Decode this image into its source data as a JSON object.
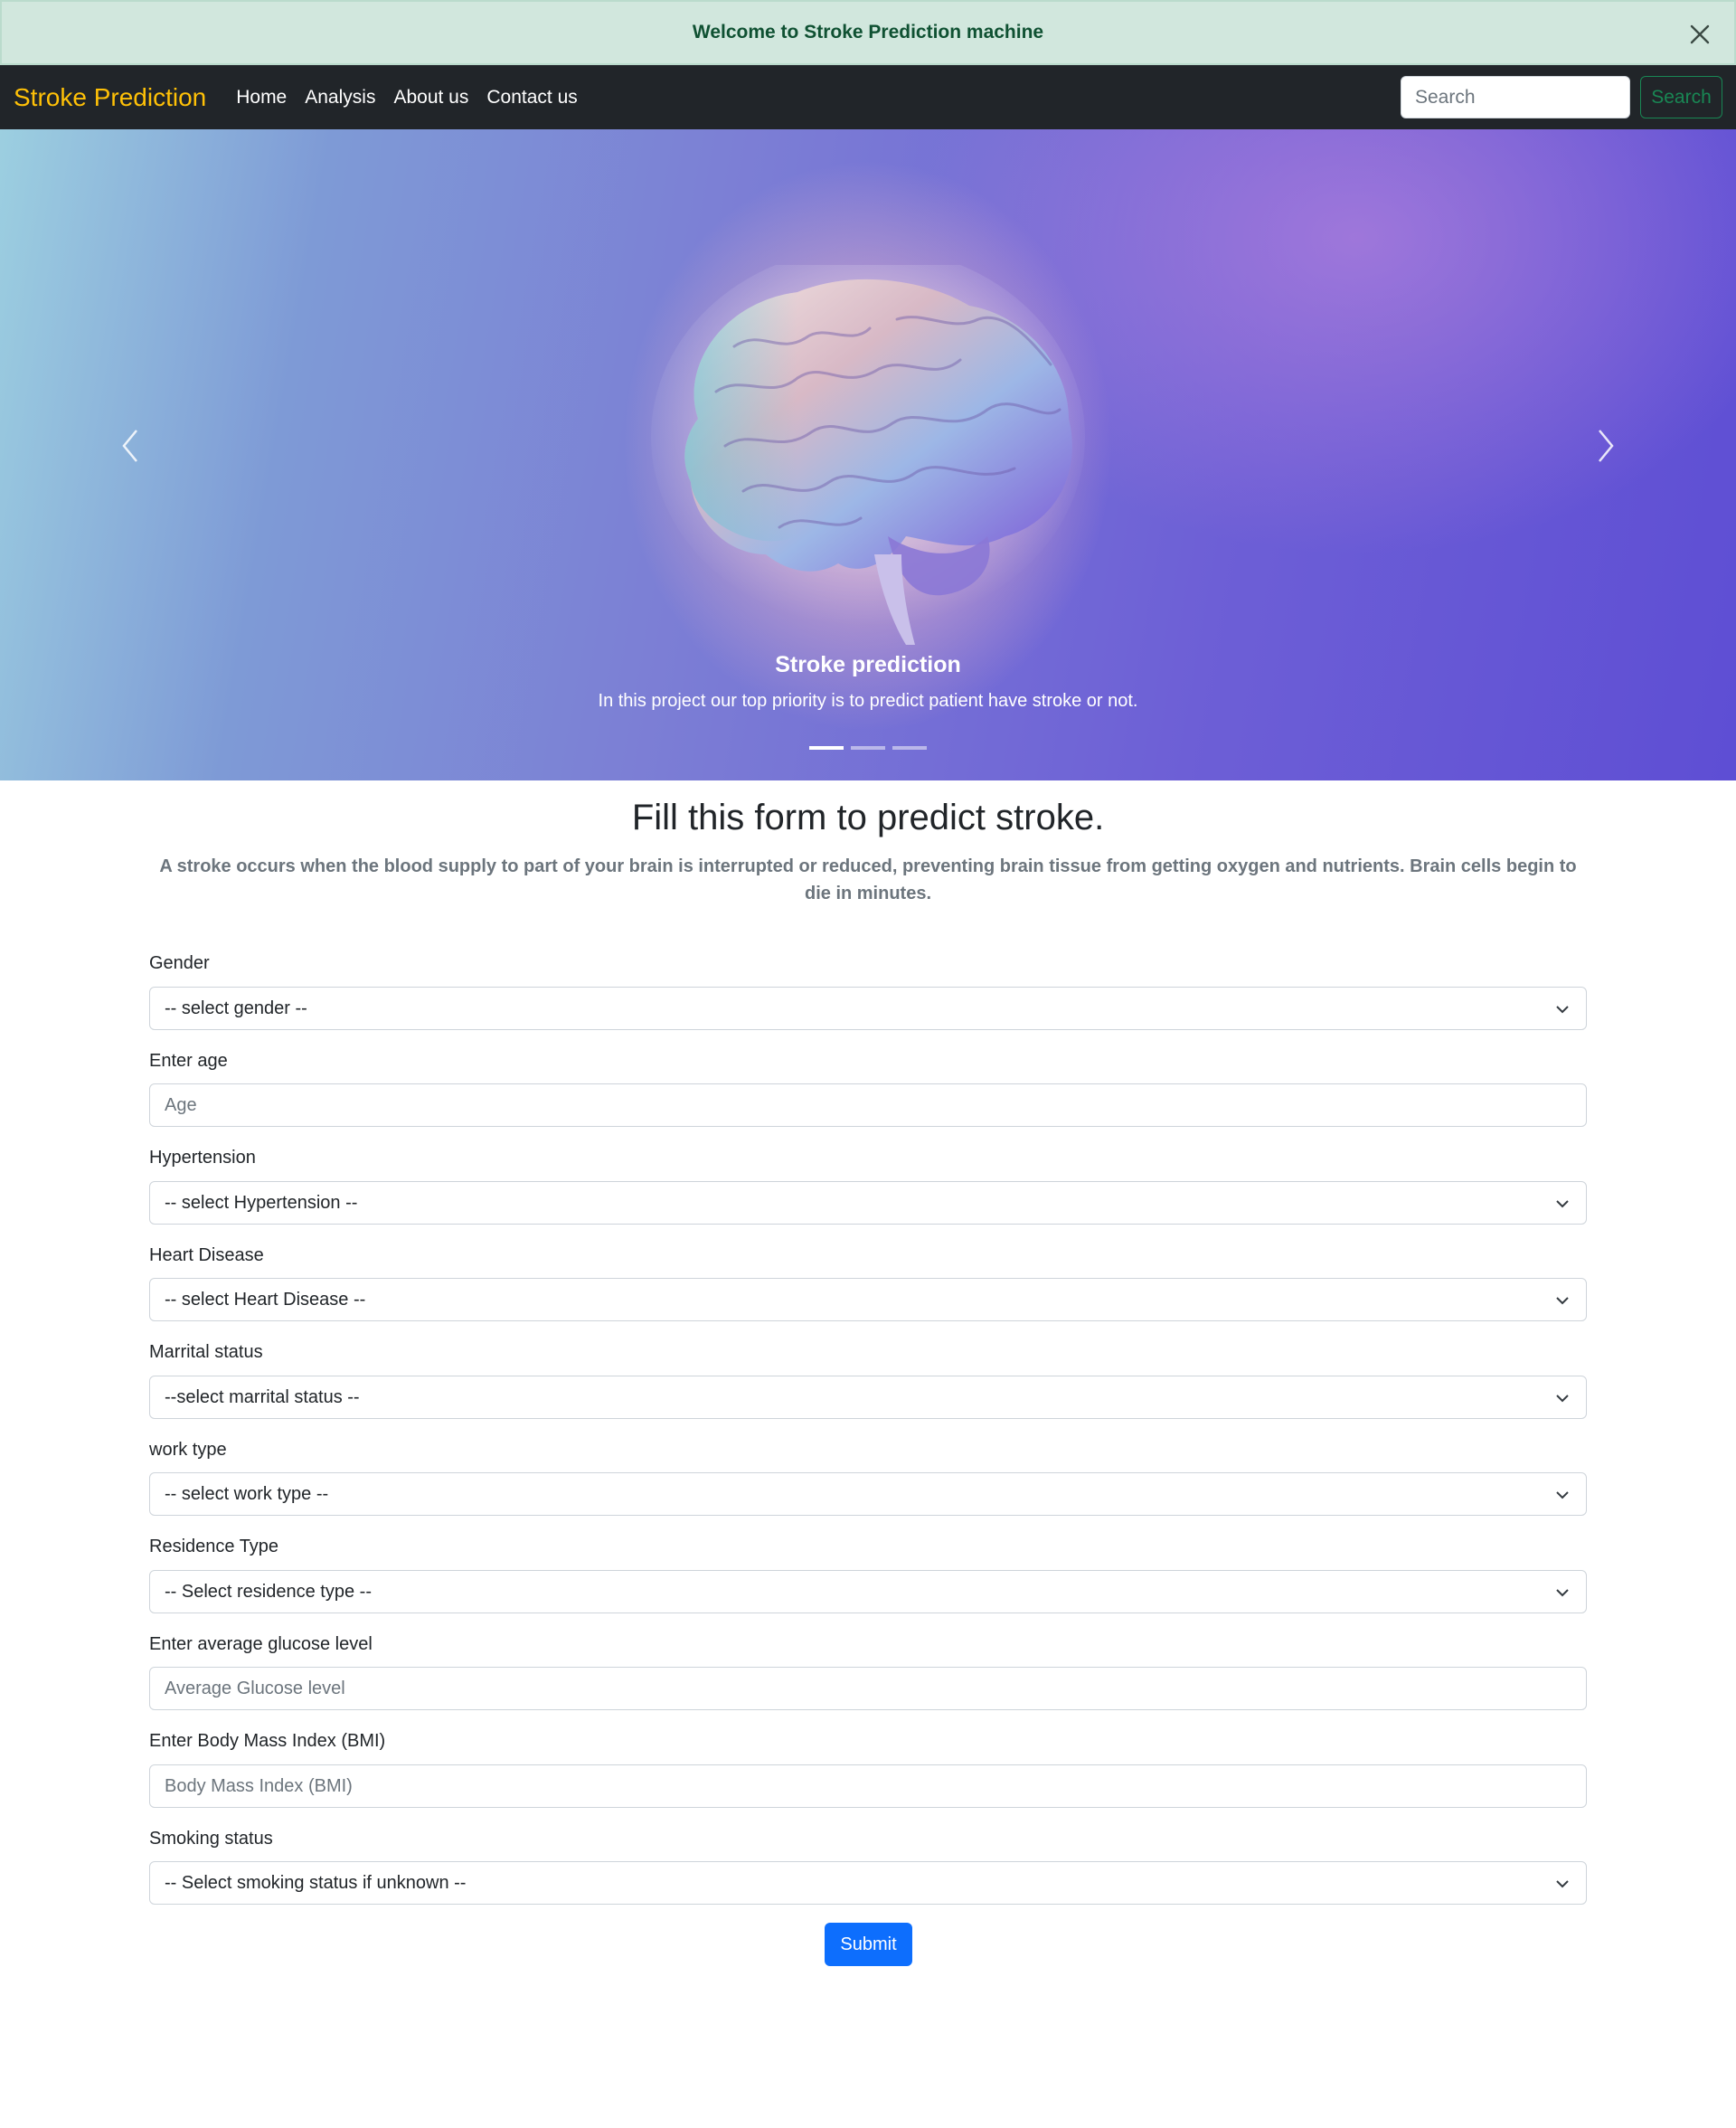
{
  "alert": {
    "text": "Welcome to Stroke Prediction machine"
  },
  "navbar": {
    "brand": "Stroke Prediction",
    "links": [
      "Home",
      "Analysis",
      "About us",
      "Contact us"
    ],
    "search_placeholder": "Search",
    "search_button": "Search"
  },
  "carousel": {
    "caption_title": "Stroke prediction",
    "caption_text": "In this project our top priority is to predict patient have stroke or not.",
    "slide_count": 3,
    "active_slide": 1
  },
  "form": {
    "title": "Fill this form to predict stroke.",
    "description": "A stroke occurs when the blood supply to part of your brain is interrupted or reduced, preventing brain tissue from getting oxygen and nutrients. Brain cells begin to die in minutes.",
    "fields": [
      {
        "label": "Gender",
        "type": "select",
        "value": "-- select gender --"
      },
      {
        "label": "Enter age",
        "type": "input",
        "placeholder": "Age"
      },
      {
        "label": "Hypertension",
        "type": "select",
        "value": "-- select Hypertension --"
      },
      {
        "label": "Heart Disease",
        "type": "select",
        "value": "-- select Heart Disease --"
      },
      {
        "label": "Marrital status",
        "type": "select",
        "value": "--select marrital status --"
      },
      {
        "label": "work type",
        "type": "select",
        "value": "-- select work type --"
      },
      {
        "label": "Residence Type",
        "type": "select",
        "value": "-- Select residence type --"
      },
      {
        "label": "Enter average glucose level",
        "type": "input",
        "placeholder": "Average Glucose level"
      },
      {
        "label": "Enter Body Mass Index (BMI)",
        "type": "input",
        "placeholder": "Body Mass Index (BMI)"
      },
      {
        "label": "Smoking status",
        "type": "select",
        "value": "-- Select smoking status if unknown --"
      }
    ],
    "submit": "Submit"
  },
  "colors": {
    "alert_bg": "#d1e7dd",
    "alert_text": "#0f5132",
    "navbar_bg": "#212529",
    "brand": "#ffc107",
    "search_outline": "#198754",
    "primary": "#0d6efd"
  }
}
